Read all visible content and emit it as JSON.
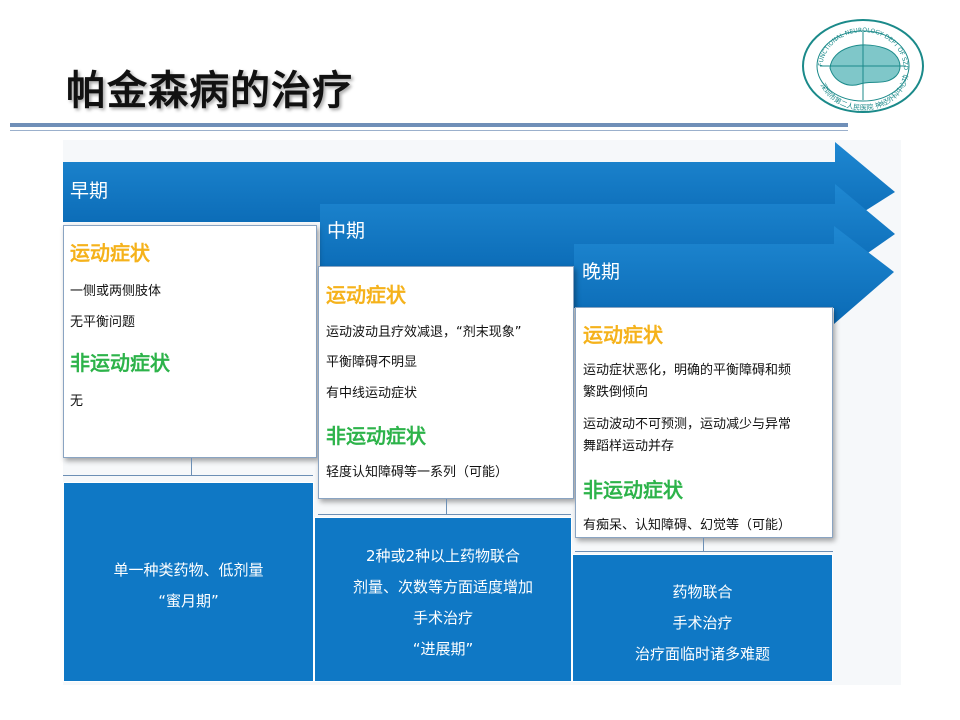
{
  "title": "帕金森病的治疗",
  "logo": {
    "text_top": "FUNCTIONAL NEUROLOGY DEPT OF SZDH",
    "text_bottom": "深圳市第二人民医院 神经外科中心功能神经外科",
    "accent_color": "#1b8a8a"
  },
  "colors": {
    "arrow_blue": "#0f78c5",
    "motor_title": "#f5b21b",
    "nonmotor_title": "#2db34a"
  },
  "phases": [
    {
      "label": "早期",
      "motor_title": "运动症状",
      "motor_items": [
        "一侧或两侧肢体",
        "无平衡问题"
      ],
      "nonmotor_title": "非运动症状",
      "nonmotor_items": [
        "无"
      ],
      "treatment": [
        "单一种类药物、低剂量",
        "“蜜月期”"
      ]
    },
    {
      "label": "中期",
      "motor_title": "运动症状",
      "motor_items": [
        "运动波动且疗效减退，“剂末现象”",
        "平衡障碍不明显",
        "有中线运动症状"
      ],
      "nonmotor_title": "非运动症状",
      "nonmotor_items": [
        "轻度认知障碍等一系列（可能）"
      ],
      "treatment": [
        "2种或2种以上药物联合",
        "剂量、次数等方面适度增加",
        "手术治疗",
        "“进展期”"
      ]
    },
    {
      "label": "晚期",
      "motor_title": "运动症状",
      "motor_items": [
        "运动症状恶化，明确的平衡障碍和频",
        "繁跌倒倾向",
        "运动波动不可预测，运动减少与异常",
        "舞蹈样运动并存"
      ],
      "nonmotor_title": "非运动症状",
      "nonmotor_items": [
        "有痴呆、认知障碍、幻觉等（可能）"
      ],
      "treatment": [
        "药物联合",
        "手术治疗",
        "治疗面临时诸多难题"
      ]
    }
  ]
}
